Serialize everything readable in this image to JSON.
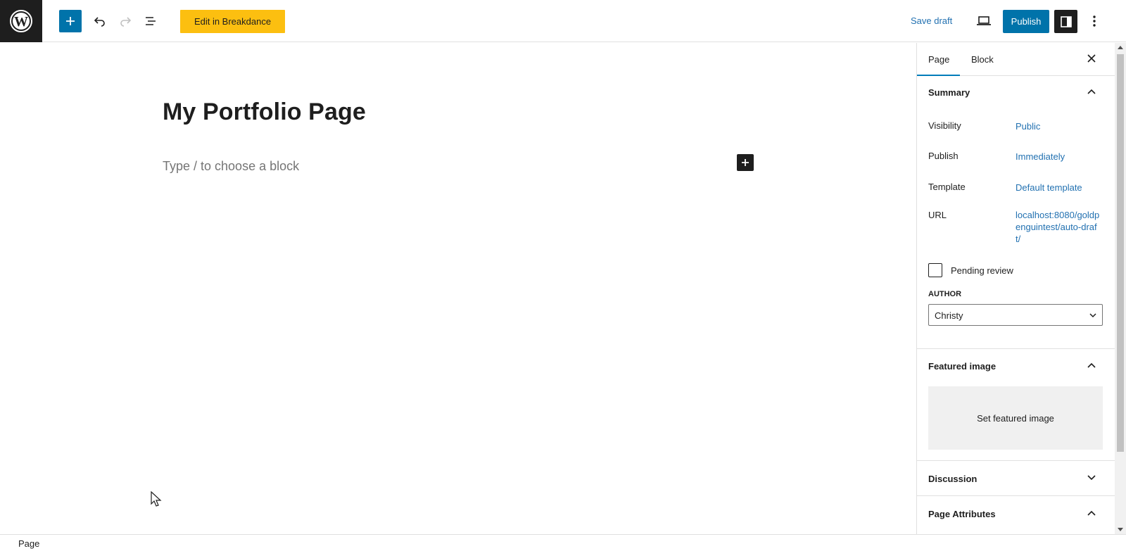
{
  "toolbar": {
    "logo_icon": "wordpress-logo-icon",
    "add_icon": "plus-icon",
    "undo_icon": "undo-icon",
    "redo_icon": "redo-icon",
    "list_view_icon": "list-view-icon",
    "breakdance_label": "Edit in Breakdance",
    "save_draft_label": "Save draft",
    "preview_icon": "laptop-icon",
    "publish_label": "Publish",
    "settings_icon": "sidebar-toggle-icon",
    "more_icon": "more-vertical-icon",
    "colors": {
      "primary": "#0073aa",
      "breakdance": "#fcbf10",
      "dark": "#1e1e1e"
    }
  },
  "editor": {
    "title": "My Portfolio Page",
    "block_placeholder": "Type / to choose a block"
  },
  "sidebar": {
    "tabs": [
      {
        "label": "Page",
        "active": true
      },
      {
        "label": "Block",
        "active": false
      }
    ],
    "summary": {
      "heading": "Summary",
      "rows": [
        {
          "label": "Visibility",
          "value": "Public"
        },
        {
          "label": "Publish",
          "value": "Immediately"
        },
        {
          "label": "Template",
          "value": "Default template"
        },
        {
          "label": "URL",
          "value": "localhost:8080/goldpenguintest/auto-draft/"
        }
      ],
      "pending_review_label": "Pending review",
      "pending_review_checked": false,
      "author_label": "AUTHOR",
      "author_value": "Christy"
    },
    "featured_image": {
      "heading": "Featured image",
      "button_label": "Set featured image"
    },
    "discussion": {
      "heading": "Discussion"
    },
    "page_attributes": {
      "heading": "Page Attributes"
    }
  },
  "footer": {
    "breadcrumb": "Page"
  }
}
